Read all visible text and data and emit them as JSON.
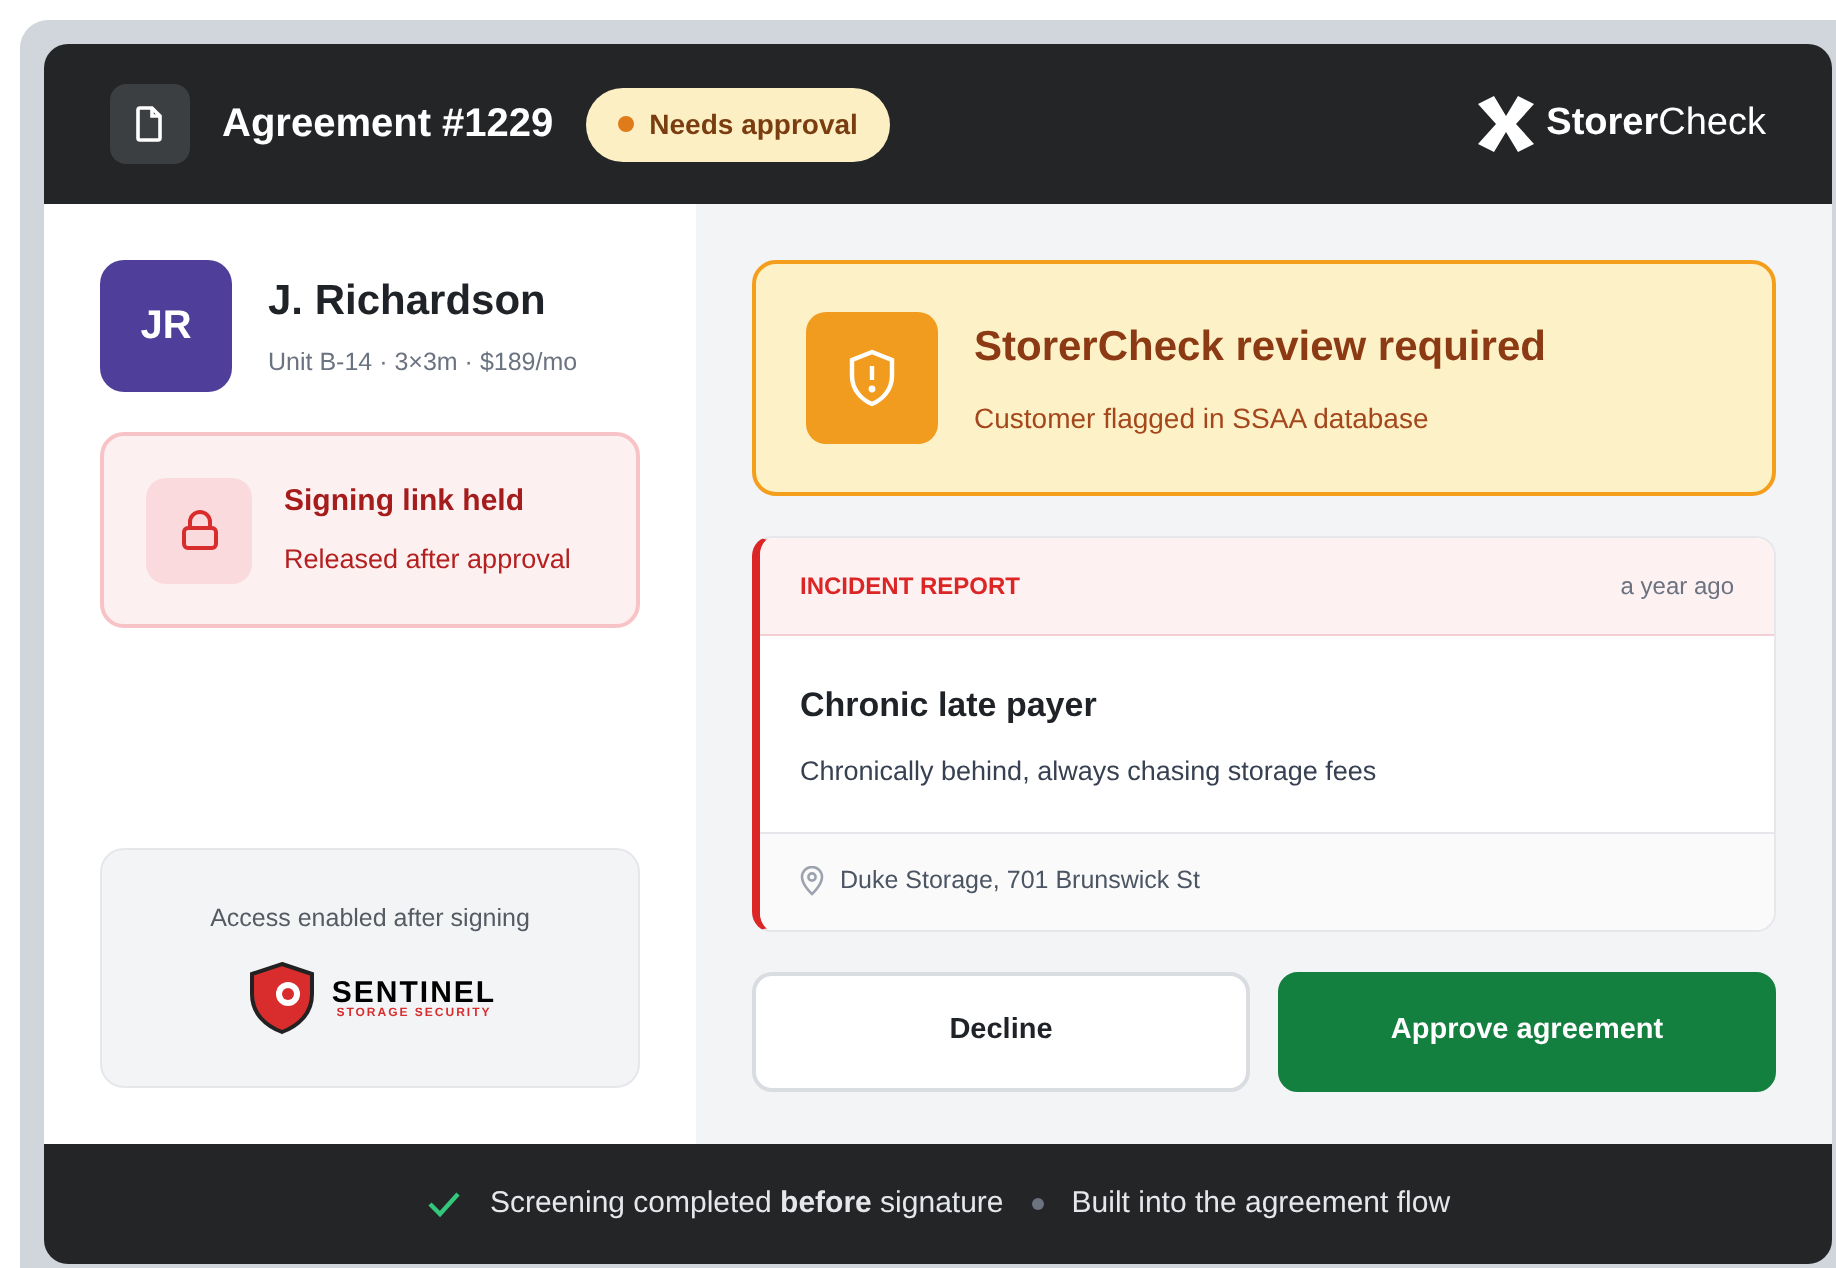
{
  "header": {
    "title": "Agreement #1229",
    "status_badge": {
      "label": "Needs approval",
      "color": "#e07b1a"
    },
    "brand": "**Storer**Check"
  },
  "customer": {
    "initials": "JR",
    "name": "J. Richardson",
    "details": "Unit B-14 · 3×3m · $189/mo"
  },
  "hold_notice": {
    "title": "Signing link held",
    "subtitle": "Released after approval"
  },
  "access_card": {
    "caption": "Access enabled after signing",
    "partner_name": "SENTINEL",
    "partner_tagline": "STORAGE SECURITY"
  },
  "alert": {
    "title": "StorerCheck review required",
    "subtitle": "Customer flagged in SSAA database"
  },
  "incident": {
    "label": "INCIDENT REPORT",
    "time": "a year ago",
    "title": "Chronic late payer",
    "description": "Chronically behind, always chasing storage fees",
    "location": "Duke Storage, 701 Brunswick St"
  },
  "buttons": [
    {
      "label": "Decline",
      "kind": "secondary"
    },
    {
      "label": "Approve agreement",
      "kind": "primary"
    }
  ],
  "footer": {
    "items": [
      "Screening completed **before** signature",
      "Built into the agreement flow"
    ]
  }
}
